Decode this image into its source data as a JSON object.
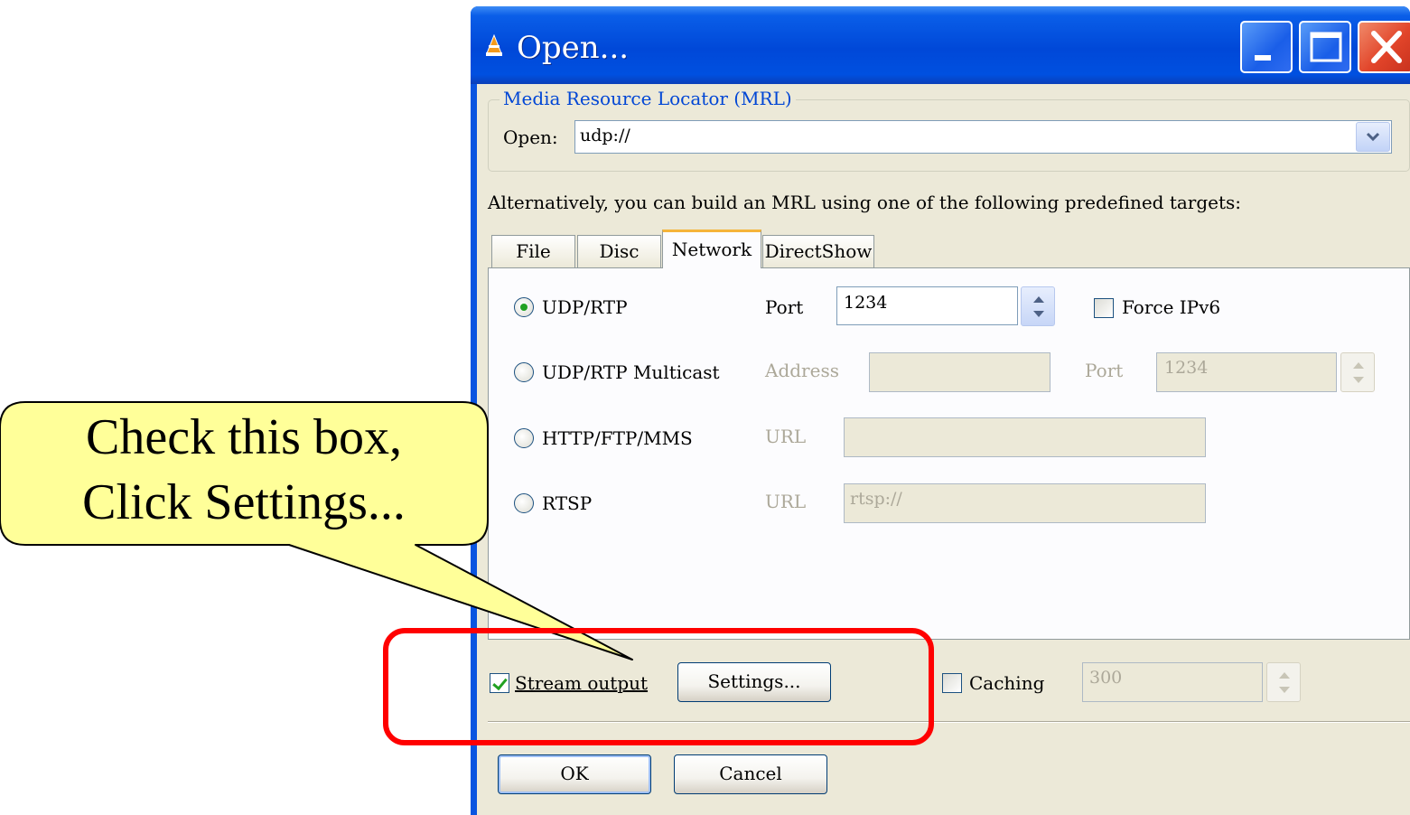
{
  "window": {
    "title": "Open...",
    "icon": "vlc-cone-icon",
    "buttons": [
      "minimize-icon",
      "maximize-icon",
      "close-icon"
    ]
  },
  "mrl": {
    "group_label": "Media Resource Locator (MRL)",
    "open_label": "Open:",
    "open_value": "udp://"
  },
  "alt_text": "Alternatively, you can build an MRL using one of the following predefined targets:",
  "tabs": [
    {
      "label": "File",
      "active": false
    },
    {
      "label": "Disc",
      "active": false
    },
    {
      "label": "Network",
      "active": true
    },
    {
      "label": "DirectShow",
      "active": false
    }
  ],
  "network": {
    "udp": {
      "label": "UDP/RTP",
      "selected": true,
      "port_label": "Port",
      "port_value": "1234",
      "force_ipv6_label": "Force IPv6",
      "force_ipv6_checked": false
    },
    "multicast": {
      "label": "UDP/RTP Multicast",
      "selected": false,
      "address_label": "Address",
      "address_value": "",
      "port_label": "Port",
      "port_value": "1234"
    },
    "http": {
      "label": "HTTP/FTP/MMS",
      "selected": false,
      "url_label": "URL",
      "url_value": ""
    },
    "rtsp": {
      "label": "RTSP",
      "selected": false,
      "url_label": "URL",
      "url_value": "rtsp://"
    }
  },
  "bottom": {
    "stream_output_label": "Stream output",
    "stream_output_checked": true,
    "settings_label": "Settings...",
    "caching_label": "Caching",
    "caching_checked": false,
    "caching_value": "300",
    "ok_label": "OK",
    "cancel_label": "Cancel"
  },
  "annotation": {
    "callout_line1": "Check this box,",
    "callout_line2": "Click Settings...",
    "callout_color": "#ffff99",
    "highlight_color": "#ff0000"
  }
}
